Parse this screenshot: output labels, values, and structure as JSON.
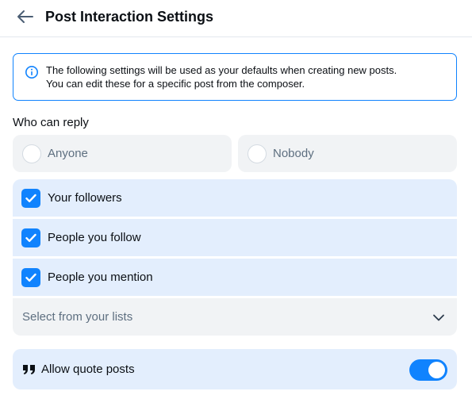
{
  "header": {
    "title": "Post Interaction Settings",
    "back_icon": "arrow-left-icon"
  },
  "info": {
    "icon": "info-circle-icon",
    "line1": "The following settings will be used as your defaults when creating new posts.",
    "line2": "You can edit these for a specific post from the composer."
  },
  "reply": {
    "section_label": "Who can reply",
    "options": [
      {
        "label": "Anyone",
        "selected": false
      },
      {
        "label": "Nobody",
        "selected": false
      }
    ],
    "checks": [
      {
        "label": "Your followers",
        "checked": true
      },
      {
        "label": "People you follow",
        "checked": true
      },
      {
        "label": "People you mention",
        "checked": true
      }
    ],
    "lists_select": {
      "label": "Select from your lists",
      "icon": "chevron-down-icon"
    }
  },
  "quote": {
    "icon": "quote-icon",
    "label": "Allow quote posts",
    "enabled": true
  },
  "colors": {
    "accent": "#1083fe",
    "selected_bg": "#e3eefd",
    "neutral_bg": "#f1f3f5",
    "muted_text": "#5e6f80"
  }
}
